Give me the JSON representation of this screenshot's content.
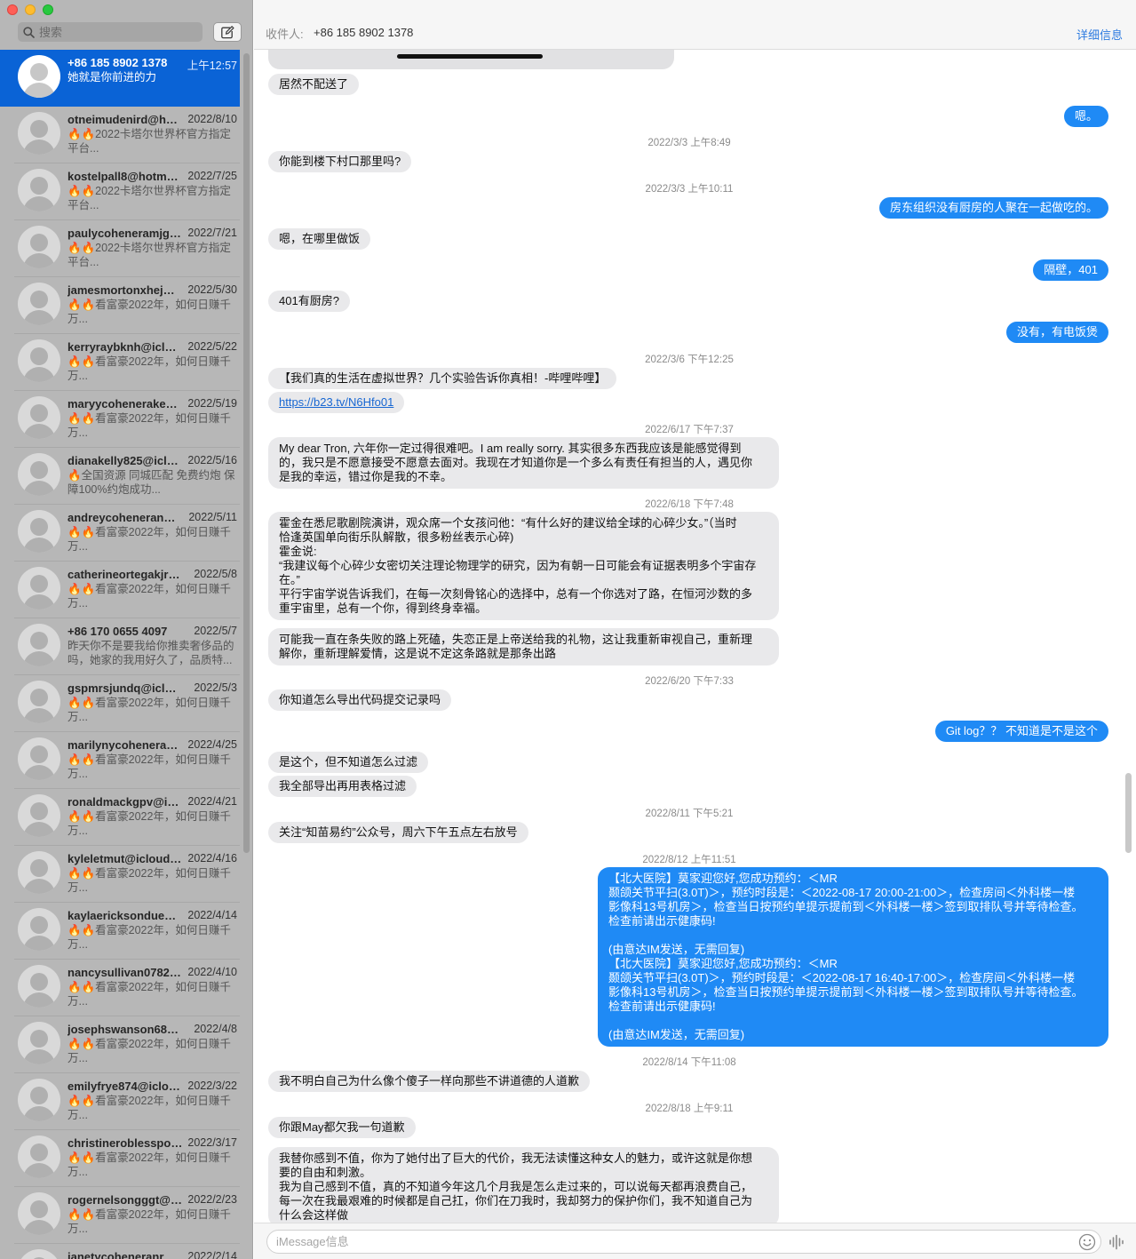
{
  "window": {
    "traffic_lights": [
      "close",
      "minimize",
      "zoom"
    ]
  },
  "sidebar": {
    "search_placeholder": "搜索",
    "compose_icon": "compose-icon",
    "conversations": [
      {
        "name": "+86 185 8902 1378",
        "date": "上午12:57",
        "preview": "她就是你前进的力",
        "selected": true
      },
      {
        "name": "otneimudenird@hotmail.com",
        "date": "2022/8/10",
        "preview": "🔥🔥2022卡塔尔世界杯官方指定平台..."
      },
      {
        "name": "kostelpall8@hotmail.com",
        "date": "2022/7/25",
        "preview": "🔥🔥2022卡塔尔世界杯官方指定平台..."
      },
      {
        "name": "paulycoheneramjgs@icloud.com",
        "date": "2022/7/21",
        "preview": "🔥🔥2022卡塔尔世界杯官方指定平台..."
      },
      {
        "name": "jamesmortonxhej@icloud.com",
        "date": "2022/5/30",
        "preview": "🔥🔥看富豪2022年，如何日赚千万..."
      },
      {
        "name": "kerryraybknh@icloud.com",
        "date": "2022/5/22",
        "preview": "🔥🔥看富豪2022年，如何日赚千万..."
      },
      {
        "name": "maryycoheneraked@icloud.com",
        "date": "2022/5/19",
        "preview": "🔥🔥看富豪2022年，如何日赚千万..."
      },
      {
        "name": "dianakelly825@icloud.com",
        "date": "2022/5/16",
        "preview": "🔥全国资源 同城匹配 免费约炮 保障100%约炮成功..."
      },
      {
        "name": "andreycoheneranwi@icloud.com",
        "date": "2022/5/11",
        "preview": "🔥🔥看富豪2022年，如何日赚千万..."
      },
      {
        "name": "catherineortegakjra@icloud.com",
        "date": "2022/5/8",
        "preview": "🔥🔥看富豪2022年，如何日赚千万..."
      },
      {
        "name": "+86 170 0655 4097",
        "date": "2022/5/7",
        "preview": "昨天你不是要我给你推卖奢侈品的吗，她家的我用好久了，品质特..."
      },
      {
        "name": "gspmrsjundq@icloud.com",
        "date": "2022/5/3",
        "preview": "🔥🔥看富豪2022年，如何日赚千万..."
      },
      {
        "name": "marilynycoheneray@icloud.com",
        "date": "2022/4/25",
        "preview": "🔥🔥看富豪2022年，如何日赚千万..."
      },
      {
        "name": "ronaldmackgpv@icloud.com",
        "date": "2022/4/21",
        "preview": "🔥🔥看富豪2022年，如何日赚千万..."
      },
      {
        "name": "kyleletmut@icloud.com",
        "date": "2022/4/16",
        "preview": "🔥🔥看富豪2022年，如何日赚千万..."
      },
      {
        "name": "kaylaericksondue@icloud.com",
        "date": "2022/4/14",
        "preview": "🔥🔥看富豪2022年，如何日赚千万..."
      },
      {
        "name": "nancysullivan0782@icloud.com",
        "date": "2022/4/10",
        "preview": "🔥🔥看富豪2022年，如何日赚千万..."
      },
      {
        "name": "josephswanson687@icloud.com",
        "date": "2022/4/8",
        "preview": "🔥🔥看富豪2022年，如何日赚千万..."
      },
      {
        "name": "emilyfrye874@icloud.com",
        "date": "2022/3/22",
        "preview": "🔥🔥看富豪2022年，如何日赚千万..."
      },
      {
        "name": "christineroblesspo@icloud.com",
        "date": "2022/3/17",
        "preview": "🔥🔥看富豪2022年，如何日赚千万..."
      },
      {
        "name": "rogernelsongggt@icloud.com",
        "date": "2022/2/23",
        "preview": "🔥🔥看富豪2022年，如何日赚千万..."
      },
      {
        "name": "janetycoheneranr@icloud.com",
        "date": "2022/2/14",
        "preview": ""
      }
    ]
  },
  "header": {
    "to_label": "收件人:",
    "to_value": "+86 185 8902 1378",
    "details": "详细信息"
  },
  "messages": {
    "m1": "居然不配送了",
    "m2": "嗯。",
    "t1": "2022/3/3 上午8:49",
    "m3": "你能到楼下村口那里吗?",
    "t2": "2022/3/3 上午10:11",
    "m4": "房东组织没有厨房的人聚在一起做吃的。",
    "m5": "嗯，在哪里做饭",
    "m6": "隔壁，401",
    "m7": "401有厨房?",
    "m8": "没有，有电饭煲",
    "t3": "2022/3/6 下午12:25",
    "m9": "【我们真的生活在虚拟世界？几个实验告诉你真相！-哔哩哔哩】",
    "m10": "https://b23.tv/N6Hfo01",
    "t4": "2022/6/17 下午7:37",
    "m11": [
      "My dear Tron, 六年你一定过得很难吧。I am really sorry. 其实很多东西我应该是能感觉得到",
      "的，我只是不愿意接受不愿意去面对。我现在才知道你是一个多么有责任有担当的人，遇见你",
      "是我的幸运，错过你是我的不幸。"
    ],
    "t5": "2022/6/18 下午7:48",
    "m12": [
      "霍金在悉尼歌剧院演讲，观众席一个女孩问他：“有什么好的建议给全球的心碎少女。”（当时",
      "恰逢英国单向街乐队解散，很多粉丝表示心碎)",
      "霍金说:",
      "“我建议每个心碎少女密切关注理论物理学的研究，因为有朝一日可能会有证据表明多个宇宙存",
      "在。”",
      "平行宇宙学说告诉我们，在每一次刻骨铭心的选择中，总有一个你选对了路，在恒河沙数的多",
      "重宇宙里，总有一个你，得到终身幸福。"
    ],
    "m13": [
      "可能我一直在条失败的路上死磕，失恋正是上帝送给我的礼物，这让我重新审视自己，重新理",
      "解你，重新理解爱情，这是说不定这条路就是那条出路"
    ],
    "t6": "2022/6/20 下午7:33",
    "m14": "你知道怎么导出代码提交记录吗",
    "m15": "Git log？？ 不知道是不是这个",
    "m16": "是这个，但不知道怎么过滤",
    "m17": "我全部导出再用表格过滤",
    "t7": "2022/8/11 下午5:21",
    "m18": "关注“知苗易约”公众号，周六下午五点左右放号",
    "t8": "2022/8/12 上午11:51",
    "m19": [
      "【北大医院】莫家迎您好,您成功预约：＜MR",
      "颞颌关节平扫(3.0T)＞，预约时段是：＜2022-08-17  20:00-21:00＞，检查房间＜外科楼一楼",
      "影像科13号机房＞，检查当日按预约单提示提前到＜外科楼一楼＞签到取排队号并等待检查。",
      "检查前请出示健康码!",
      "",
      "(由意达IM发送，无需回复)",
      "【北大医院】莫家迎您好,您成功预约：＜MR",
      "颞颌关节平扫(3.0T)＞，预约时段是：＜2022-08-17  16:40-17:00＞，检查房间＜外科楼一楼",
      "影像科13号机房＞，检查当日按预约单提示提前到＜外科楼一楼＞签到取排队号并等待检查。",
      "检查前请出示健康码!",
      "",
      "(由意达IM发送，无需回复)"
    ],
    "t9": "2022/8/14 下午11:08",
    "m20": "我不明白自己为什么像个傻子一样向那些不讲道德的人道歉",
    "t10": "2022/8/18 上午9:11",
    "m21": "你跟May都欠我一句道歉",
    "m22": [
      "我替你感到不值，你为了她付出了巨大的代价，我无法读懂这种女人的魅力，或许这就是你想",
      "要的自由和刺激。",
      "我为自己感到不值，真的不知道今年这几个月我是怎么走过来的，可以说每天都再浪费自己，",
      "每一次在我最艰难的时候都是自己扛，你们在刀我时，我却努力的保护你们，我不知道自己为",
      "什么会这样做"
    ]
  },
  "input": {
    "placeholder": "iMessage信息",
    "emoji_icon": "emoji-icon",
    "audio_icon": "audio-waveform-icon"
  }
}
